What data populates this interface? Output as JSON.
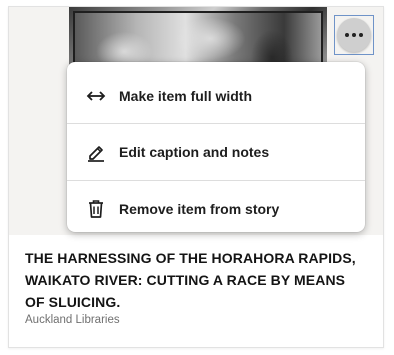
{
  "menu": {
    "items": [
      {
        "label": "Make item full width",
        "icon": "arrows-horizontal-icon"
      },
      {
        "label": "Edit caption and notes",
        "icon": "pencil-icon"
      },
      {
        "label": "Remove item from story",
        "icon": "trash-icon"
      }
    ]
  },
  "item": {
    "caption": "THE HARNESSING OF THE HORAHORA RAPIDS, WAIKATO RIVER: CUTTING A RACE BY MEANS OF SLUICING.",
    "source": "Auckland Libraries"
  },
  "colors": {
    "more_button_focus": "#6f93c8",
    "more_button_bg": "#cfcfcf",
    "image_area_bg": "#f4f3f1"
  }
}
